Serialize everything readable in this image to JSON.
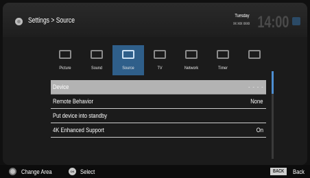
{
  "header": {
    "breadcrumb": "Settings > Source",
    "clock": {
      "day": "Tuesday",
      "date": "xx xxx xxxx",
      "time": "14:00"
    }
  },
  "categories": [
    {
      "label": "Picture",
      "icon": "picture-icon",
      "active": false
    },
    {
      "label": "Sound",
      "icon": "sound-icon",
      "active": false
    },
    {
      "label": "Source",
      "icon": "source-icon",
      "active": true
    },
    {
      "label": "TV",
      "icon": "tv-icon",
      "active": false
    },
    {
      "label": "Network",
      "icon": "network-icon",
      "active": false
    },
    {
      "label": "Timer",
      "icon": "timer-icon",
      "active": false
    },
    {
      "label": "",
      "icon": "system-icon",
      "active": false
    }
  ],
  "menu": [
    {
      "label": "Device",
      "value": "- - - -",
      "selected": true
    },
    {
      "label": "Remote Behavior",
      "value": "None",
      "selected": false
    },
    {
      "label": "Put device into standby",
      "value": "",
      "selected": false
    },
    {
      "label": "4K Enhanced Support",
      "value": "On",
      "selected": false
    }
  ],
  "scroll_position": 0.0,
  "footer": {
    "change_area": "Change Area",
    "ok_key": "OK",
    "select": "Select",
    "back_key": "BACK",
    "back": "Back"
  },
  "colors": {
    "accent": "#2f5f8a",
    "selected_row": "#b3b3b3",
    "scroll_thumb": "#4d8ed1"
  }
}
